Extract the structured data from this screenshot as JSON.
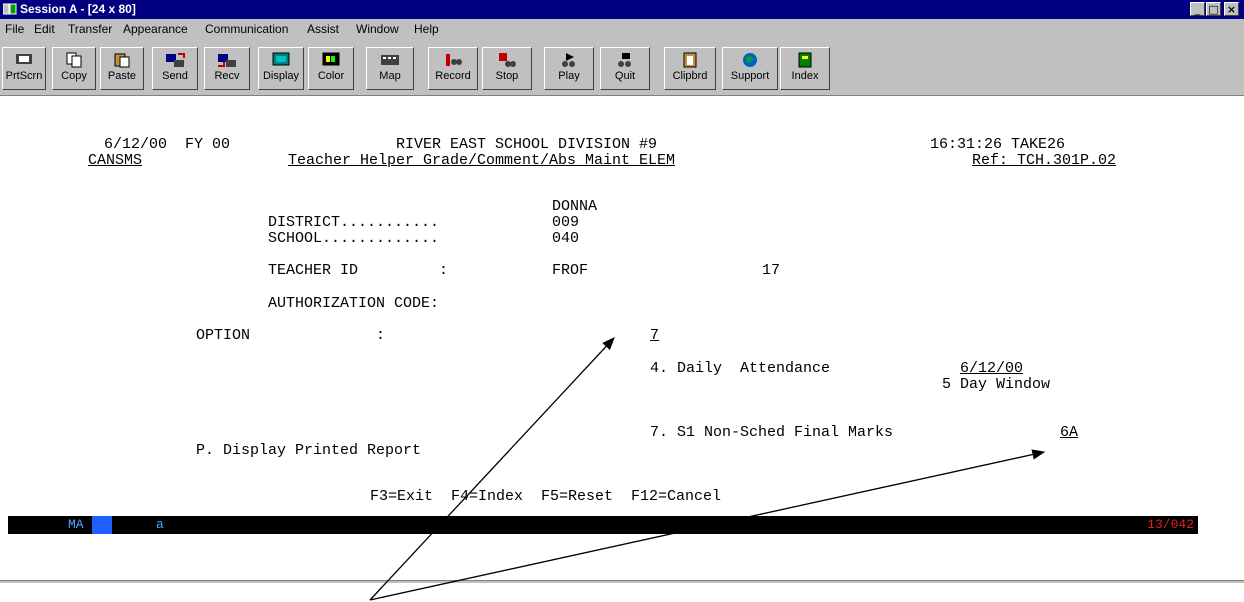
{
  "window": {
    "title": "Session A - [24 x 80]",
    "minimize": "_",
    "maximize": "□",
    "close": "×"
  },
  "menu": [
    "File",
    "Edit",
    "Transfer",
    "Appearance",
    "Communication",
    "Assist",
    "Window",
    "Help"
  ],
  "toolbar": [
    "PrtScrn",
    "Copy",
    "Paste",
    "Send",
    "Recv",
    "Display",
    "Color",
    "Map",
    "Record",
    "Stop",
    "Play",
    "Quit",
    "Clipbrd",
    "Support",
    "Index"
  ],
  "screen": {
    "line1_left": "6/12/00  FY 00",
    "line1_center": "RIVER EAST SCHOOL DIVISION #9",
    "line1_right": "16:31:26 TAKE26",
    "line2_left": "CANSMS",
    "line2_center": "Teacher Helper Grade/Comment/Abs Maint ELEM",
    "line2_right": "Ref: TCH.301P.02",
    "user": "DONNA",
    "district_label": "DISTRICT...........",
    "district_value": "009",
    "school_label": "SCHOOL.............",
    "school_value": "040",
    "teacher_label": "TEACHER ID         :",
    "teacher_value": "FROF",
    "teacher_num": "17",
    "auth_label": "AUTHORIZATION CODE:",
    "option_label": "OPTION              :",
    "option_value": "7",
    "opt4": "4. Daily  Attendance",
    "opt4_date": "6/12/00",
    "opt4_window": "5 Day Window",
    "opt7": "7. S1 Non-Sched Final Marks",
    "opt7_value": "6A",
    "optP": "P. Display Printed Report",
    "fkeys": "F3=Exit  F4=Index  F5=Reset  F12=Cancel"
  },
  "status": {
    "mode": "MA",
    "indicator": "a",
    "cursor_pos": "13/042"
  },
  "colors": {
    "titlebar": "#000080",
    "chrome": "#c0c0c0",
    "status_text": "#4aa8ff",
    "status_pos": "#e02020"
  }
}
